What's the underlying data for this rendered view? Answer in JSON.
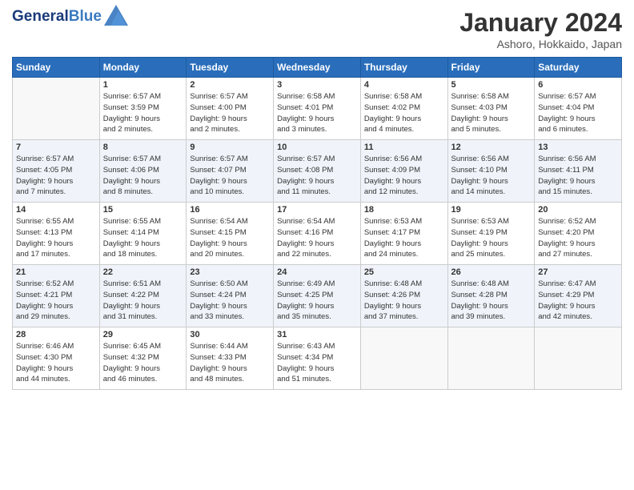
{
  "header": {
    "logo_line1": "General",
    "logo_line2": "Blue",
    "month": "January 2024",
    "location": "Ashoro, Hokkaido, Japan"
  },
  "days_of_week": [
    "Sunday",
    "Monday",
    "Tuesday",
    "Wednesday",
    "Thursday",
    "Friday",
    "Saturday"
  ],
  "weeks": [
    [
      {
        "day": "",
        "info": ""
      },
      {
        "day": "1",
        "info": "Sunrise: 6:57 AM\nSunset: 3:59 PM\nDaylight: 9 hours\nand 2 minutes."
      },
      {
        "day": "2",
        "info": "Sunrise: 6:57 AM\nSunset: 4:00 PM\nDaylight: 9 hours\nand 2 minutes."
      },
      {
        "day": "3",
        "info": "Sunrise: 6:58 AM\nSunset: 4:01 PM\nDaylight: 9 hours\nand 3 minutes."
      },
      {
        "day": "4",
        "info": "Sunrise: 6:58 AM\nSunset: 4:02 PM\nDaylight: 9 hours\nand 4 minutes."
      },
      {
        "day": "5",
        "info": "Sunrise: 6:58 AM\nSunset: 4:03 PM\nDaylight: 9 hours\nand 5 minutes."
      },
      {
        "day": "6",
        "info": "Sunrise: 6:57 AM\nSunset: 4:04 PM\nDaylight: 9 hours\nand 6 minutes."
      }
    ],
    [
      {
        "day": "7",
        "info": "Sunrise: 6:57 AM\nSunset: 4:05 PM\nDaylight: 9 hours\nand 7 minutes."
      },
      {
        "day": "8",
        "info": "Sunrise: 6:57 AM\nSunset: 4:06 PM\nDaylight: 9 hours\nand 8 minutes."
      },
      {
        "day": "9",
        "info": "Sunrise: 6:57 AM\nSunset: 4:07 PM\nDaylight: 9 hours\nand 10 minutes."
      },
      {
        "day": "10",
        "info": "Sunrise: 6:57 AM\nSunset: 4:08 PM\nDaylight: 9 hours\nand 11 minutes."
      },
      {
        "day": "11",
        "info": "Sunrise: 6:56 AM\nSunset: 4:09 PM\nDaylight: 9 hours\nand 12 minutes."
      },
      {
        "day": "12",
        "info": "Sunrise: 6:56 AM\nSunset: 4:10 PM\nDaylight: 9 hours\nand 14 minutes."
      },
      {
        "day": "13",
        "info": "Sunrise: 6:56 AM\nSunset: 4:11 PM\nDaylight: 9 hours\nand 15 minutes."
      }
    ],
    [
      {
        "day": "14",
        "info": "Sunrise: 6:55 AM\nSunset: 4:13 PM\nDaylight: 9 hours\nand 17 minutes."
      },
      {
        "day": "15",
        "info": "Sunrise: 6:55 AM\nSunset: 4:14 PM\nDaylight: 9 hours\nand 18 minutes."
      },
      {
        "day": "16",
        "info": "Sunrise: 6:54 AM\nSunset: 4:15 PM\nDaylight: 9 hours\nand 20 minutes."
      },
      {
        "day": "17",
        "info": "Sunrise: 6:54 AM\nSunset: 4:16 PM\nDaylight: 9 hours\nand 22 minutes."
      },
      {
        "day": "18",
        "info": "Sunrise: 6:53 AM\nSunset: 4:17 PM\nDaylight: 9 hours\nand 24 minutes."
      },
      {
        "day": "19",
        "info": "Sunrise: 6:53 AM\nSunset: 4:19 PM\nDaylight: 9 hours\nand 25 minutes."
      },
      {
        "day": "20",
        "info": "Sunrise: 6:52 AM\nSunset: 4:20 PM\nDaylight: 9 hours\nand 27 minutes."
      }
    ],
    [
      {
        "day": "21",
        "info": "Sunrise: 6:52 AM\nSunset: 4:21 PM\nDaylight: 9 hours\nand 29 minutes."
      },
      {
        "day": "22",
        "info": "Sunrise: 6:51 AM\nSunset: 4:22 PM\nDaylight: 9 hours\nand 31 minutes."
      },
      {
        "day": "23",
        "info": "Sunrise: 6:50 AM\nSunset: 4:24 PM\nDaylight: 9 hours\nand 33 minutes."
      },
      {
        "day": "24",
        "info": "Sunrise: 6:49 AM\nSunset: 4:25 PM\nDaylight: 9 hours\nand 35 minutes."
      },
      {
        "day": "25",
        "info": "Sunrise: 6:48 AM\nSunset: 4:26 PM\nDaylight: 9 hours\nand 37 minutes."
      },
      {
        "day": "26",
        "info": "Sunrise: 6:48 AM\nSunset: 4:28 PM\nDaylight: 9 hours\nand 39 minutes."
      },
      {
        "day": "27",
        "info": "Sunrise: 6:47 AM\nSunset: 4:29 PM\nDaylight: 9 hours\nand 42 minutes."
      }
    ],
    [
      {
        "day": "28",
        "info": "Sunrise: 6:46 AM\nSunset: 4:30 PM\nDaylight: 9 hours\nand 44 minutes."
      },
      {
        "day": "29",
        "info": "Sunrise: 6:45 AM\nSunset: 4:32 PM\nDaylight: 9 hours\nand 46 minutes."
      },
      {
        "day": "30",
        "info": "Sunrise: 6:44 AM\nSunset: 4:33 PM\nDaylight: 9 hours\nand 48 minutes."
      },
      {
        "day": "31",
        "info": "Sunrise: 6:43 AM\nSunset: 4:34 PM\nDaylight: 9 hours\nand 51 minutes."
      },
      {
        "day": "",
        "info": ""
      },
      {
        "day": "",
        "info": ""
      },
      {
        "day": "",
        "info": ""
      }
    ]
  ]
}
